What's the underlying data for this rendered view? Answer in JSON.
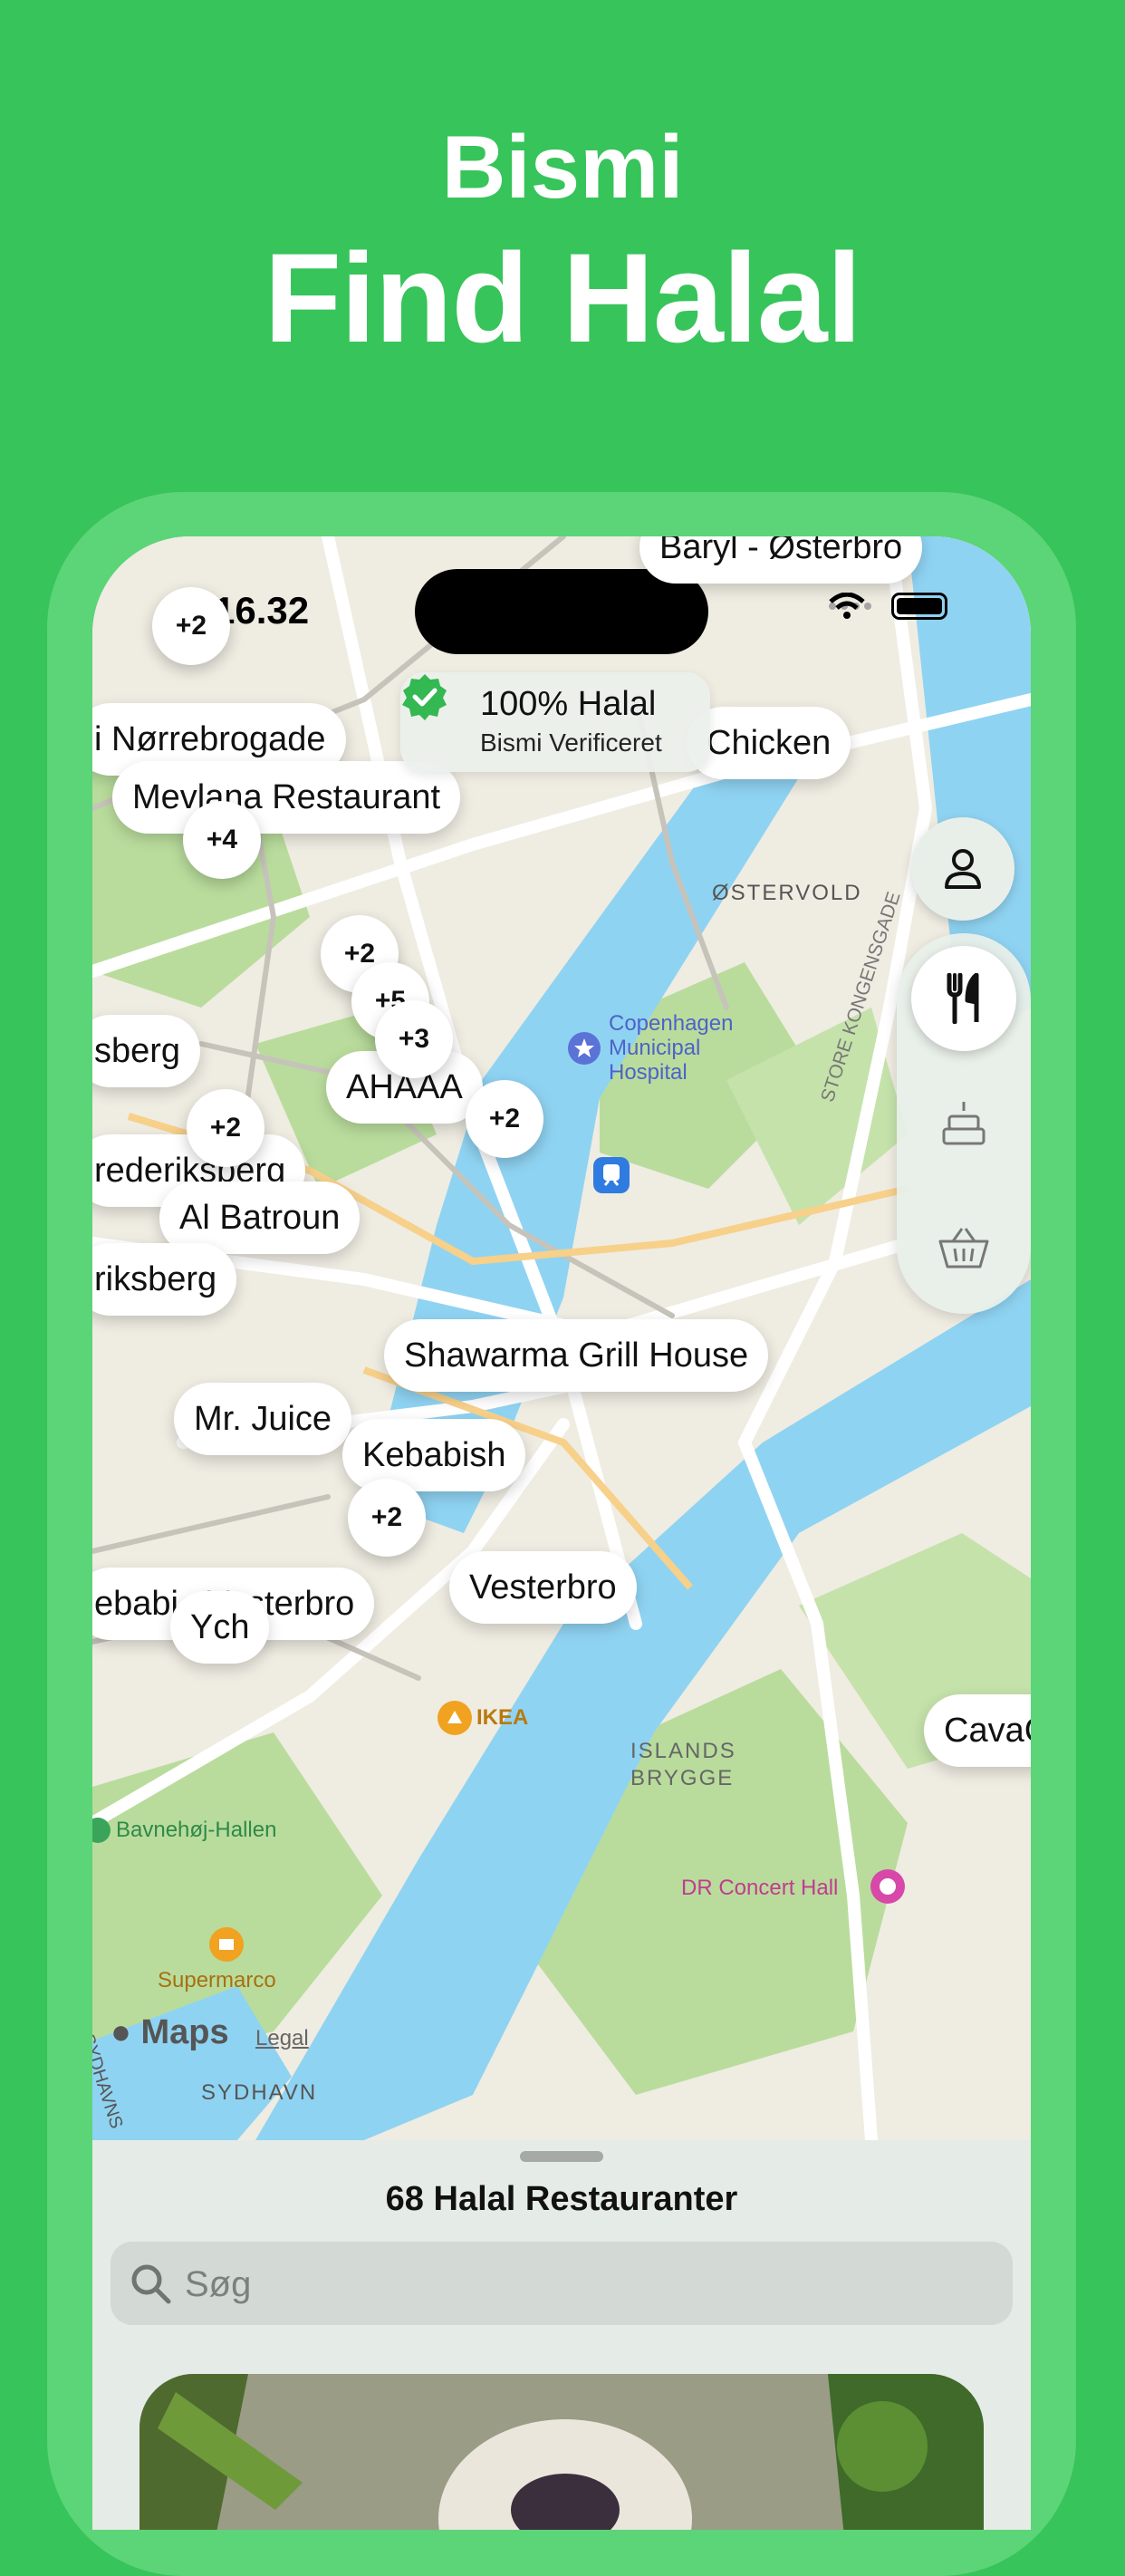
{
  "promo": {
    "app_name": "Bismi",
    "tagline": "Find Halal"
  },
  "status_bar": {
    "time": "16.32"
  },
  "badge": {
    "title": "100% Halal",
    "subtitle": "Bismi Verificeret"
  },
  "pins": {
    "baryl": "Baryl - Østerbro",
    "norrebrogade": "i Nørrebrogade",
    "chicken": "Chicken",
    "mevlana": "Mevlana Restaurant",
    "sberg": "sberg",
    "ahaaa": "AHAAA",
    "frederiksberg": "rederiksberg",
    "al_batroun": "Al Batroun",
    "riksberg": "riksberg",
    "shawarma": "Shawarma Grill House",
    "mr_juice": "Mr. Juice",
    "kebabish": "Kebabish",
    "vesterbro_a": "Vesterbro",
    "vesterbro_b": "ebabi   Vesterbro",
    "ych": "Ych",
    "cava": "CavaC"
  },
  "clusters": {
    "c1": "+2",
    "c2": "+4",
    "c3": "+2",
    "c4": "+5",
    "c5": "+3",
    "c6": "+2",
    "c7": "+2",
    "c8": "+2"
  },
  "map_labels": {
    "ostervold": "ØSTERVOLD",
    "hospital": "Copenhagen\nMunicipal\nHospital",
    "store_kongensgade": "STORE KONGENSGADE",
    "ikea": "IKEA",
    "islands_brygge": "ISLANDS\nBRYGGE",
    "bavnehoj": "Bavnehøj-Hallen",
    "dr_concert": "DR Concert Hall",
    "supermarco": "Supermarco",
    "sydhavn": "SYDHAVN",
    "sydhavns": "SYDHAVNS",
    "maps": "Maps",
    "legal": "Legal"
  },
  "sheet": {
    "title": "68 Halal Restauranter",
    "search_placeholder": "Søg"
  },
  "icons": {
    "profile": "person-icon",
    "restaurants": "fork-knife-icon",
    "bakery": "cake-icon",
    "grocery": "basket-icon",
    "search": "search-icon",
    "verified": "checkmark-seal-icon"
  },
  "colors": {
    "brand_green": "#37c45a",
    "frame_green": "#5cd478",
    "water": "#8fd3f2",
    "park": "#b9dc9c"
  }
}
